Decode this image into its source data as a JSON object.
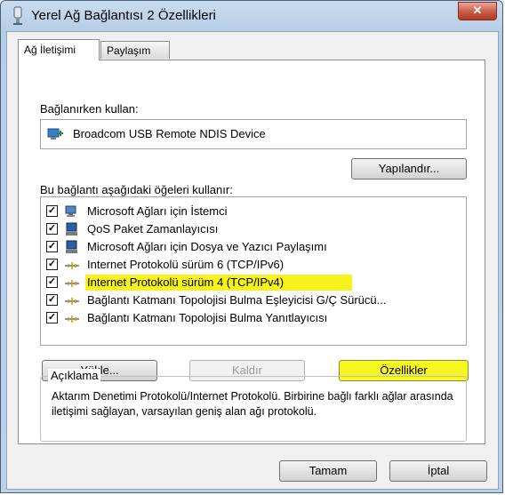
{
  "window": {
    "title": "Yerel Ağ Bağlantısı 2 Özellikleri",
    "close_glyph": "✕"
  },
  "tabs": [
    {
      "label": "Ağ İletişimi"
    },
    {
      "label": "Paylaşım"
    }
  ],
  "connect_using": {
    "label": "Bağlanırken kullan:",
    "device_name": "Broadcom USB Remote NDIS Device",
    "configure_button": "Yapılandır..."
  },
  "components": {
    "label": "Bu bağlantı aşağıdaki öğeleri kullanır:",
    "items": [
      {
        "label": "Microsoft Ağları için İstemci",
        "checked": true,
        "icon": "network-client-icon"
      },
      {
        "label": "QoS Paket Zamanlayıcısı",
        "checked": true,
        "icon": "network-service-icon"
      },
      {
        "label": "Microsoft Ağları için Dosya ve Yazıcı Paylaşımı",
        "checked": true,
        "icon": "network-service-icon"
      },
      {
        "label": "Internet Protokolü sürüm 6 (TCP/IPv6)",
        "checked": true,
        "icon": "protocol-icon"
      },
      {
        "label": "Internet Protokolü sürüm 4 (TCP/IPv4)",
        "checked": true,
        "icon": "protocol-icon",
        "highlighted": true
      },
      {
        "label": "Bağlantı Katmanı Topolojisi Bulma Eşleyicisi G/Ç Sürücü...",
        "checked": true,
        "icon": "protocol-icon"
      },
      {
        "label": "Bağlantı Katmanı Topolojisi Bulma Yanıtlayıcısı",
        "checked": true,
        "icon": "protocol-icon"
      }
    ],
    "check_glyph": "✓"
  },
  "actions": {
    "install": "Yükle...",
    "uninstall": "Kaldır",
    "properties": "Özellikler"
  },
  "description": {
    "legend": "Açıklama",
    "text": "Aktarım Denetimi Protokolü/Internet Protokolü. Birbirine bağlı farklı ağlar arasında iletişimi sağlayan, varsayılan geniş alan ağı protokolü."
  },
  "footer": {
    "ok": "Tamam",
    "cancel": "İptal"
  },
  "colors": {
    "highlight": "#f7f11c",
    "title_bar": "#c9dcef"
  }
}
